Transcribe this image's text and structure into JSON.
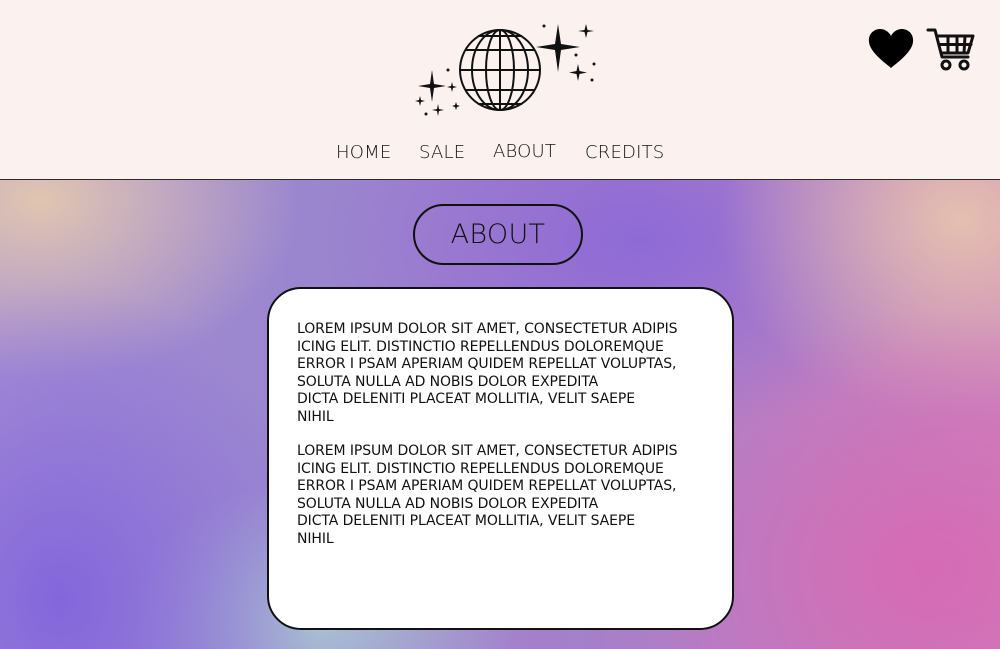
{
  "header": {
    "nav": [
      {
        "key": "home",
        "label": "HOME"
      },
      {
        "key": "sale",
        "label": "SALE"
      },
      {
        "key": "about",
        "label": "ABOUT"
      },
      {
        "key": "credits",
        "label": "CREDITS"
      }
    ],
    "icons": {
      "logo": "disco-globe-sparkles-icon",
      "wishlist": "heart-icon",
      "cart": "shopping-cart-icon"
    }
  },
  "main": {
    "section_title": "ABOUT",
    "paragraphs": [
      "LOREM IPSUM DOLOR SIT AMET, CONSECTETUR ADIPIS\nICING ELIT. DISTINCTIO REPELLENDUS DOLOREMQUE\nERROR I PSAM APERIAM QUIDEM REPELLAT VOLUPTAS,\nSOLUTA NULLA AD NOBIS DOLOR EXPEDITA\nDICTA DELENITI PLACEAT MOLLITIA, VELIT SAEPE\nNIHIL",
      "LOREM IPSUM DOLOR SIT AMET, CONSECTETUR ADIPIS\nICING ELIT. DISTINCTIO REPELLENDUS DOLOREMQUE\nERROR I PSAM APERIAM QUIDEM REPELLAT VOLUPTAS,\nSOLUTA NULLA AD NOBIS DOLOR EXPEDITA\nDICTA DELENITI PLACEAT MOLLITIA, VELIT SAEPE\nNIHIL"
    ]
  },
  "colors": {
    "header_bg": "#fbf1ef",
    "text": "#111111",
    "card_bg": "#ffffff",
    "gradient_purple": "#8264dc",
    "gradient_pink": "#d769b4",
    "gradient_peach": "#e4c8af"
  }
}
